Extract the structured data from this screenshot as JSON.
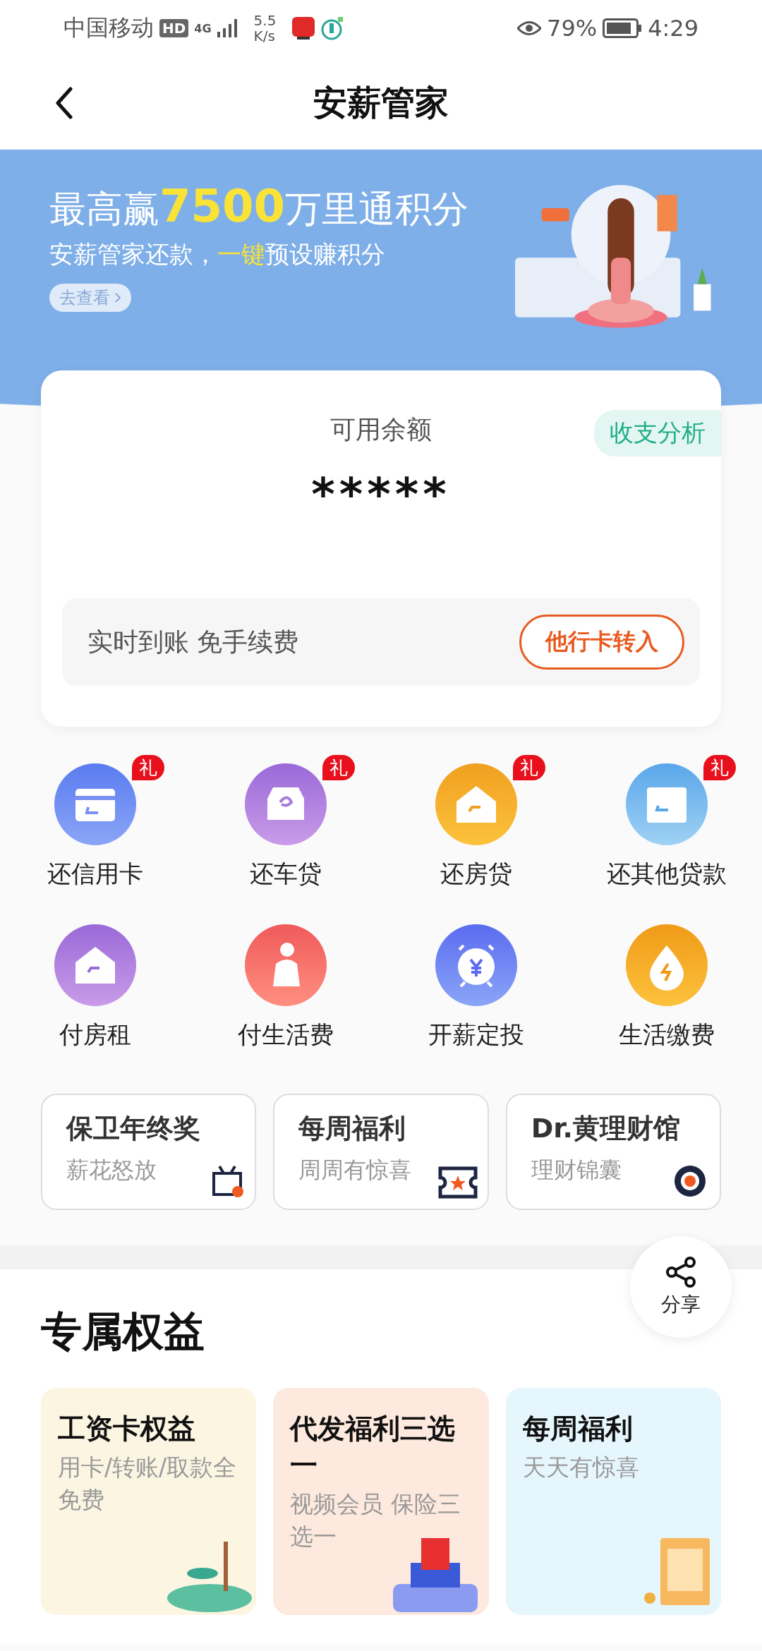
{
  "status_bar": {
    "carrier": "中国移动",
    "hd": "HD",
    "network": "4G",
    "speed_value": "5.5",
    "speed_unit": "K/s",
    "battery_percent": "79%",
    "time": "4:29"
  },
  "header": {
    "title": "安薪管家"
  },
  "banner": {
    "headline": [
      {
        "text": "最高赢",
        "highlight": false
      },
      {
        "text": "7500",
        "highlight": true
      },
      {
        "text": "万里通积分",
        "highlight": false
      }
    ],
    "subtitle": [
      {
        "text": "安薪管家还款，",
        "highlight": false
      },
      {
        "text": "一键",
        "highlight": true
      },
      {
        "text": "预设赚积分",
        "highlight": false
      }
    ],
    "button": "去查看"
  },
  "balance": {
    "label": "可用余额",
    "amount": "*****",
    "analysis_tag": "收支分析",
    "note": "实时到账 免手续费",
    "transfer_button": "他行卡转入"
  },
  "services": [
    {
      "label": "还信用卡",
      "badge": "礼"
    },
    {
      "label": "还车贷",
      "badge": "礼"
    },
    {
      "label": "还房贷",
      "badge": "礼"
    },
    {
      "label": "还其他贷款",
      "badge": "礼"
    },
    {
      "label": "付房租"
    },
    {
      "label": "付生活费"
    },
    {
      "label": "开薪定投"
    },
    {
      "label": "生活缴费"
    }
  ],
  "promos": [
    {
      "title": "保卫年终奖",
      "subtitle": "薪花怒放"
    },
    {
      "title": "每周福利",
      "subtitle": "周周有惊喜"
    },
    {
      "title": "Dr.黄理财馆",
      "subtitle": "理财锦囊"
    }
  ],
  "share": {
    "label": "分享"
  },
  "section_title": "专属权益",
  "benefits": [
    {
      "title": "工资卡权益",
      "subtitle": "用卡/转账/取款全免费"
    },
    {
      "title": "代发福利三选一",
      "subtitle": "视频会员 保险三选一"
    },
    {
      "title": "每周福利",
      "subtitle": "天天有惊喜"
    }
  ]
}
